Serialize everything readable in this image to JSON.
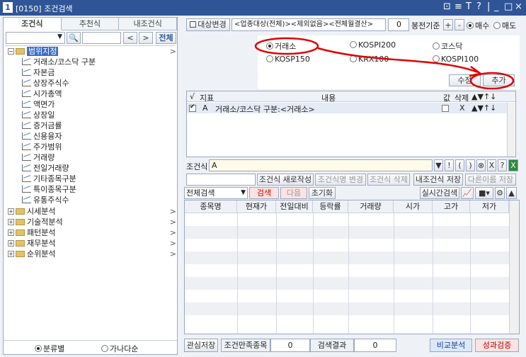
{
  "window": {
    "number": "1",
    "title": "[0150] 조건검색",
    "controls": [
      "⊡",
      "≡",
      "T",
      "?",
      "|",
      "_",
      "□",
      "×"
    ]
  },
  "left": {
    "tabs": [
      "조건식",
      "추천식",
      "내조건식"
    ],
    "search": {
      "placeholder": "",
      "prev": "<",
      "next": ">",
      "all_button": "전체"
    },
    "tree": [
      {
        "label": "범위지정",
        "type": "folder-open",
        "selected": true
      },
      {
        "label": "거래소/코스닥 구분",
        "type": "leaf"
      },
      {
        "label": "자본금",
        "type": "leaf"
      },
      {
        "label": "상장주식수",
        "type": "leaf"
      },
      {
        "label": "시가총액",
        "type": "leaf"
      },
      {
        "label": "액면가",
        "type": "leaf"
      },
      {
        "label": "상장일",
        "type": "leaf"
      },
      {
        "label": "증거금률",
        "type": "leaf"
      },
      {
        "label": "신용융자",
        "type": "leaf"
      },
      {
        "label": "주가범위",
        "type": "leaf"
      },
      {
        "label": "거래량",
        "type": "leaf"
      },
      {
        "label": "전일거래량",
        "type": "leaf"
      },
      {
        "label": "기타종목구분",
        "type": "leaf"
      },
      {
        "label": "특이종목구분",
        "type": "leaf"
      },
      {
        "label": "유통주식수",
        "type": "leaf"
      },
      {
        "label": "시세분석",
        "type": "folder"
      },
      {
        "label": "기술적분석",
        "type": "folder"
      },
      {
        "label": "패턴분석",
        "type": "folder"
      },
      {
        "label": "재무분석",
        "type": "folder"
      },
      {
        "label": "순위분석",
        "type": "folder"
      }
    ],
    "bottom_radios": [
      "분류별",
      "가나다순"
    ]
  },
  "right": {
    "target_label": "대상변경",
    "target_value": "<업종대상(전체)><제외없음><전체월결산>",
    "bong_value": "0",
    "bong_label": "봉전기준",
    "plus": "+",
    "minus": "-",
    "buy_label": "매수",
    "sell_label": "매도",
    "options": [
      "거래소",
      "KOSPI200",
      "코스닥",
      "KOSP150",
      "KRX100",
      "KOSPI100"
    ],
    "modify_button": "수정",
    "add_button": "추가",
    "table_headers": [
      "√",
      "지표",
      "내용",
      "값",
      "삭제",
      "▲▼↑↓"
    ],
    "table_rows": [
      {
        "indicator": "A",
        "content": "거래소/코스닥 구분:<거래소>",
        "delete": "X",
        "moves": "▲▼↑↓"
      }
    ],
    "condition_label": "조건식",
    "condition_value": "A",
    "cond_tools": [
      "▼",
      "!",
      "(",
      ")",
      "⊗",
      "X",
      "?"
    ],
    "action_buttons": [
      "조건식 새로작성",
      "조건식명 변경",
      "조건식 삭제",
      "내조건식 저장",
      "다른이름 저장"
    ],
    "search_scope": "전체검색",
    "search_button": "검색",
    "next_button": "다음",
    "reset_button": "초기화",
    "realtime_button": "실시간검색",
    "result_headers": [
      "종목명",
      "현재가",
      "전일대비",
      "등락률",
      "거래량",
      "시가",
      "고가",
      "저가"
    ],
    "interest_save": "관심저장",
    "matched_label": "조건만족종목",
    "matched_count": "0",
    "result_label": "검색결과",
    "result_count": "0",
    "compare_button": "비교분석",
    "perf_button": "성과검증",
    "colors": {
      "accent": "#2f5597",
      "annotation": "#e00000"
    }
  }
}
